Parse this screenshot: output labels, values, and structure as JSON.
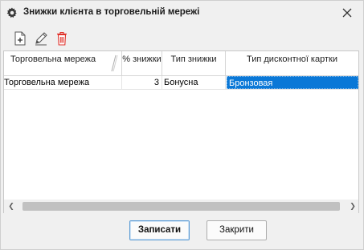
{
  "window": {
    "title": "Знижки клієнта в торговельній мережі",
    "icon": "gear-icon",
    "close_icon": "close-icon"
  },
  "toolbar": {
    "items": [
      {
        "name": "add-icon",
        "color": "#555555"
      },
      {
        "name": "edit-pencil-icon",
        "color": "#555555"
      },
      {
        "name": "delete-trash-icon",
        "color": "#e0322b"
      }
    ]
  },
  "grid": {
    "columns": [
      {
        "label": "Торговельна мережа"
      },
      {
        "label": "% знижки"
      },
      {
        "label": "Тип знижки"
      },
      {
        "label": "Тип дисконтної картки"
      }
    ],
    "rows": [
      {
        "network": "Торговельна мережа",
        "percent": "3",
        "discount_type": "Бонусна",
        "card_type": "Бронзовая"
      }
    ]
  },
  "colors": {
    "selection": "#0a78d7",
    "primary_border": "#5b9bd5",
    "delete_red": "#e0322b"
  },
  "buttons": {
    "save_label": "Записати",
    "close_label": "Закрити"
  }
}
